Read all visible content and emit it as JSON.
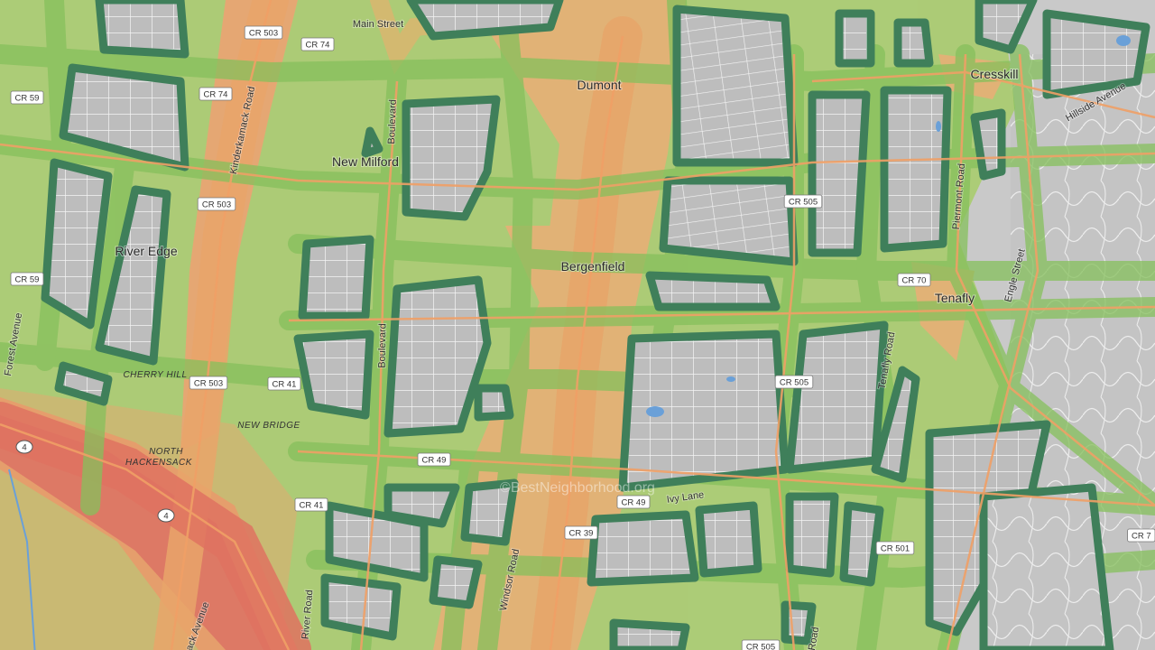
{
  "map": {
    "watermark": "©BestNeighborhood.org",
    "towns": [
      {
        "id": "dumont",
        "name": "Dumont"
      },
      {
        "id": "new-milford",
        "name": "New Milford"
      },
      {
        "id": "bergenfield",
        "name": "Bergenfield"
      },
      {
        "id": "river-edge",
        "name": "River Edge"
      },
      {
        "id": "tenafly",
        "name": "Tenafly"
      },
      {
        "id": "cresskill",
        "name": "Cresskill"
      }
    ],
    "areas": [
      {
        "id": "cherry-hill",
        "name": "CHERRY HILL"
      },
      {
        "id": "new-bridge",
        "name": "NEW BRIDGE"
      },
      {
        "id": "north-hackensack-1",
        "name": "NORTH"
      },
      {
        "id": "north-hackensack-2",
        "name": "HACKENSACK"
      }
    ],
    "roads": [
      {
        "id": "main-street",
        "name": "Main Street"
      },
      {
        "id": "kinderkamack-road",
        "name": "Kinderkamack Road"
      },
      {
        "id": "boulevard-north",
        "name": "Boulevard"
      },
      {
        "id": "boulevard-south",
        "name": "Boulevard"
      },
      {
        "id": "forest-avenue",
        "name": "Forest Avenue"
      },
      {
        "id": "hillside-avenue",
        "name": "Hillside Avenue"
      },
      {
        "id": "piermont-road",
        "name": "Piermont Road"
      },
      {
        "id": "engle-street",
        "name": "Engle Street"
      },
      {
        "id": "tenafly-road",
        "name": "Tenafly Road"
      },
      {
        "id": "ivy-lane",
        "name": "Ivy Lane"
      },
      {
        "id": "windsor-road",
        "name": "Windsor Road"
      },
      {
        "id": "river-road",
        "name": "River Road"
      },
      {
        "id": "hackensack-avenue",
        "name": "ack Avenue"
      },
      {
        "id": "cr-road-bottom",
        "name": "Road"
      }
    ],
    "shields": [
      {
        "id": "cr503-a",
        "text": "CR 503"
      },
      {
        "id": "cr74-a",
        "text": "CR 74"
      },
      {
        "id": "cr59-a",
        "text": "CR 59"
      },
      {
        "id": "cr74-b",
        "text": "CR 74"
      },
      {
        "id": "cr503-b",
        "text": "CR 503"
      },
      {
        "id": "cr59-b",
        "text": "CR 59"
      },
      {
        "id": "cr503-c",
        "text": "CR 503"
      },
      {
        "id": "cr41-a",
        "text": "CR 41"
      },
      {
        "id": "cr49-a",
        "text": "CR 49"
      },
      {
        "id": "cr41-b",
        "text": "CR 41"
      },
      {
        "id": "cr49-b",
        "text": "CR 49"
      },
      {
        "id": "cr39",
        "text": "CR 39"
      },
      {
        "id": "cr505-a",
        "text": "CR 505"
      },
      {
        "id": "cr505-b",
        "text": "CR 505"
      },
      {
        "id": "cr70",
        "text": "CR 70"
      },
      {
        "id": "cr501",
        "text": "CR 501"
      },
      {
        "id": "cr505-c",
        "text": "CR 505"
      },
      {
        "id": "cr7-edge",
        "text": "CR 7"
      },
      {
        "id": "rt4-a",
        "text": "4"
      },
      {
        "id": "rt4-b",
        "text": "4"
      }
    ],
    "colors": {
      "base": "#c9c9c9",
      "block": "#b9b9b9",
      "street": "#ffffff",
      "dark_green": "#3f7f5a",
      "green": "#8fc46a",
      "yellow_green": "#b9c86a",
      "orange": "#e8a46a",
      "red": "#de6a5a"
    }
  }
}
